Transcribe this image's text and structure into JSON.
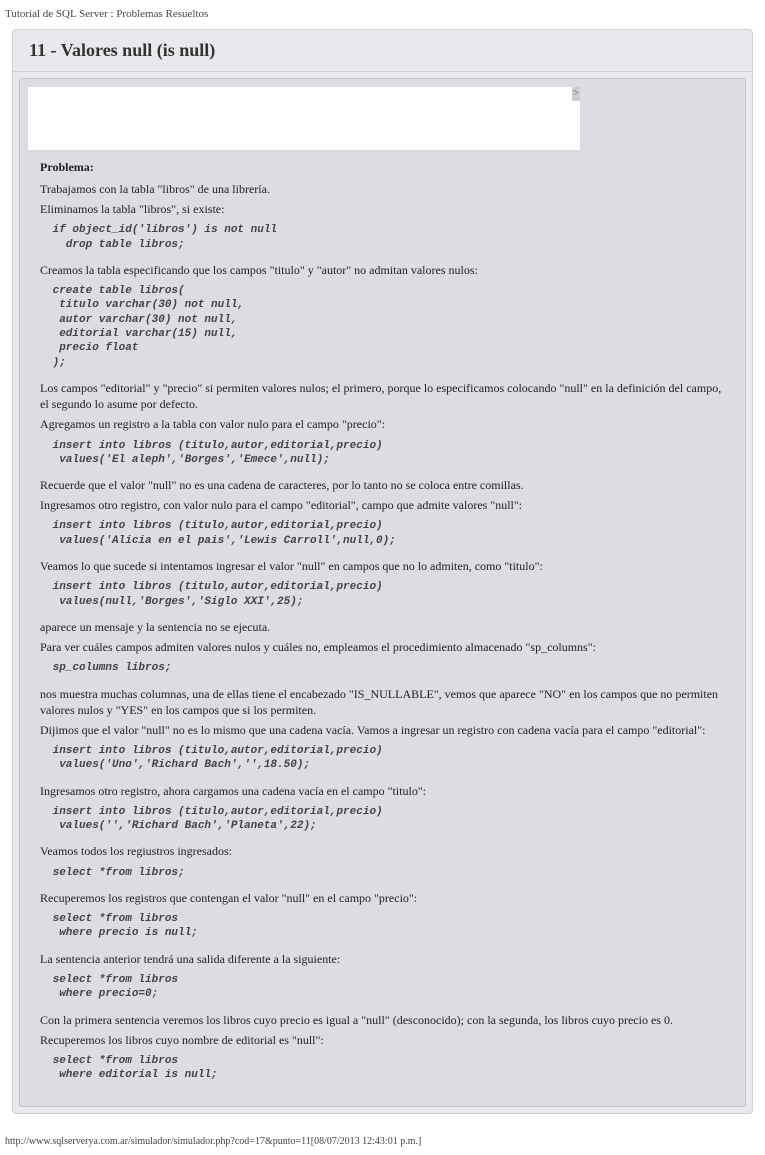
{
  "header": "Tutorial de SQL Server : Problemas Resueltos",
  "title": "11 - Valores null (is null)",
  "whitebox_corner": ">",
  "section_label": "Problema:",
  "p1": "Trabajamos con la tabla \"libros\" de una librería.",
  "p2": "Eliminamos la tabla \"libros\", si existe:",
  "code1": " if object_id('libros') is not null\n   drop table libros;",
  "p3": "Creamos la tabla especificando que los campos \"titulo\" y \"autor\" no admitan valores nulos:",
  "code2": " create table libros(\n  titulo varchar(30) not null,\n  autor varchar(30) not null,\n  editorial varchar(15) null,\n  precio float\n );",
  "p4": "Los campos \"editorial\" y \"precio\" si permiten valores nulos; el primero, porque lo especificamos colocando \"null\" en la definición del campo, el segundo lo asume por defecto.",
  "p5": "Agregamos un registro a la tabla con valor nulo para el campo \"precio\":",
  "code3": " insert into libros (titulo,autor,editorial,precio)\n  values('El aleph','Borges','Emece',null);",
  "p6": "Recuerde que el valor \"null\" no es una cadena de caracteres, por lo tanto no se coloca entre comillas.",
  "p7": "Ingresamos otro registro, con valor nulo para el campo \"editorial\", campo que admite valores \"null\":",
  "code4": " insert into libros (titulo,autor,editorial,precio)\n  values('Alicia en el pais','Lewis Carroll',null,0);",
  "p8": "Veamos lo que sucede si intentamos ingresar el valor \"null\" en campos que no lo admiten, como \"titulo\":",
  "code5": " insert into libros (titulo,autor,editorial,precio)\n  values(null,'Borges','Siglo XXI',25);",
  "p9": "aparece un mensaje y la sentencia no se ejecuta.",
  "p10": "Para ver cuáles campos admiten valores nulos y cuáles no, empleamos el procedimiento almacenado \"sp_columns\":",
  "code6": " sp_columns libros;",
  "p11": "nos muestra muchas columnas, una de ellas tiene el encabezado \"IS_NULLABLE\", vemos que aparece \"NO\" en los campos que no permiten valores nulos y \"YES\" en los campos que si los permiten.",
  "p12": "Dijimos que el valor \"null\" no es lo mismo que una cadena vacía. Vamos a ingresar un registro con cadena vacía para el campo \"editorial\":",
  "code7": " insert into libros (titulo,autor,editorial,precio)\n  values('Uno','Richard Bach','',18.50);",
  "p13": "Ingresamos otro registro, ahora cargamos una cadena vacía en el campo \"titulo\":",
  "code8": " insert into libros (titulo,autor,editorial,precio)\n  values('','Richard Bach','Planeta',22);",
  "p14": "Veamos todos los regiustros ingresados:",
  "code9": " select *from libros;",
  "p15": "Recuperemos los registros que contengan el valor \"null\" en el campo \"precio\":",
  "code10": " select *from libros\n  where precio is null;",
  "p16": "La sentencia anterior tendrá una salida diferente a la siguiente:",
  "code11": " select *from libros\n  where precio=0;",
  "p17": "Con la primera sentencia veremos los libros cuyo precio es igual a \"null\" (desconocido); con la segunda, los libros cuyo precio es 0.",
  "p18": "Recuperemos los libros cuyo nombre de editorial es \"null\":",
  "code12": " select *from libros\n  where editorial is null;",
  "footer": "http://www.sqlserverya.com.ar/simulador/simulador.php?cod=17&punto=11[08/07/2013 12:43:01 p.m.]"
}
